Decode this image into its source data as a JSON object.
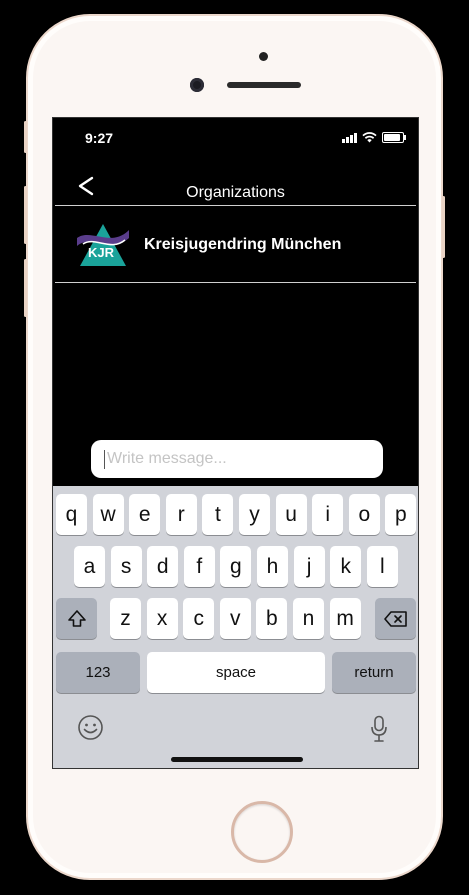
{
  "status_bar": {
    "time": "9:27"
  },
  "nav": {
    "title": "Organizations"
  },
  "organizations": [
    {
      "name": "Kreisjugendring München",
      "logo_text": "KJR"
    }
  ],
  "message_input": {
    "placeholder": "Write message...",
    "value": ""
  },
  "keyboard": {
    "row1": [
      "q",
      "w",
      "e",
      "r",
      "t",
      "y",
      "u",
      "i",
      "o",
      "p"
    ],
    "row2": [
      "a",
      "s",
      "d",
      "f",
      "g",
      "h",
      "j",
      "k",
      "l"
    ],
    "row3": [
      "z",
      "x",
      "c",
      "v",
      "b",
      "n",
      "m"
    ],
    "numbers_label": "123",
    "space_label": "space",
    "return_label": "return"
  },
  "colors": {
    "logo_teal": "#1aa39a",
    "logo_purple": "#5a3d8c",
    "screen_bg": "#000000",
    "keyboard_bg": "#d1d3d9"
  }
}
